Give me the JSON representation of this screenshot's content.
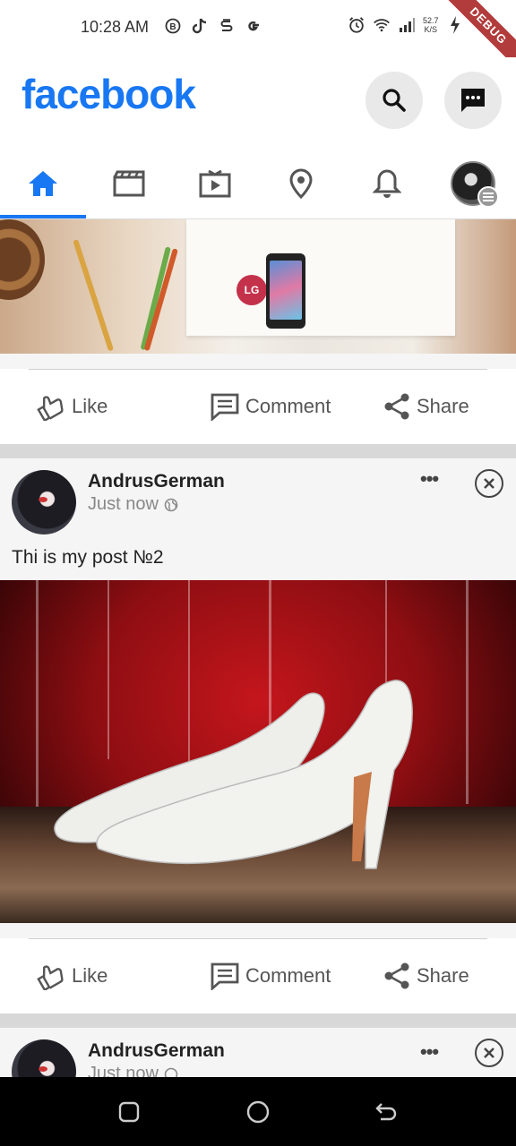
{
  "status_bar": {
    "time": "10:28 AM",
    "left_icons": [
      "b-circle-icon",
      "tiktok-icon",
      "s-icon",
      "google-icon"
    ],
    "right_icons": [
      "alarm-icon",
      "wifi-icon",
      "signal-icon",
      "battery-charging-icon"
    ],
    "net_speed_value": "52.7",
    "net_speed_unit": "K/S",
    "debug_banner": "DEBUG"
  },
  "app_bar": {
    "logo": "facebook",
    "brand_color": "#1877f2"
  },
  "tabs": [
    {
      "name": "home",
      "icon": "home-icon",
      "active": true
    },
    {
      "name": "video",
      "icon": "video-icon",
      "active": false
    },
    {
      "name": "watch",
      "icon": "watch-icon",
      "active": false
    },
    {
      "name": "places",
      "icon": "location-icon",
      "active": false
    },
    {
      "name": "notifications",
      "icon": "bell-icon",
      "active": false
    },
    {
      "name": "menu",
      "icon": "avatar-menu-icon",
      "active": false
    }
  ],
  "actions": {
    "like": "Like",
    "comment": "Comment",
    "share": "Share"
  },
  "posts": [
    {
      "author": "AndrusGerman",
      "time": "Just now",
      "text": "Thi is my post №2",
      "more": "•••"
    },
    {
      "author": "AndrusGerman",
      "time": "Just now",
      "more": "•••"
    }
  ]
}
